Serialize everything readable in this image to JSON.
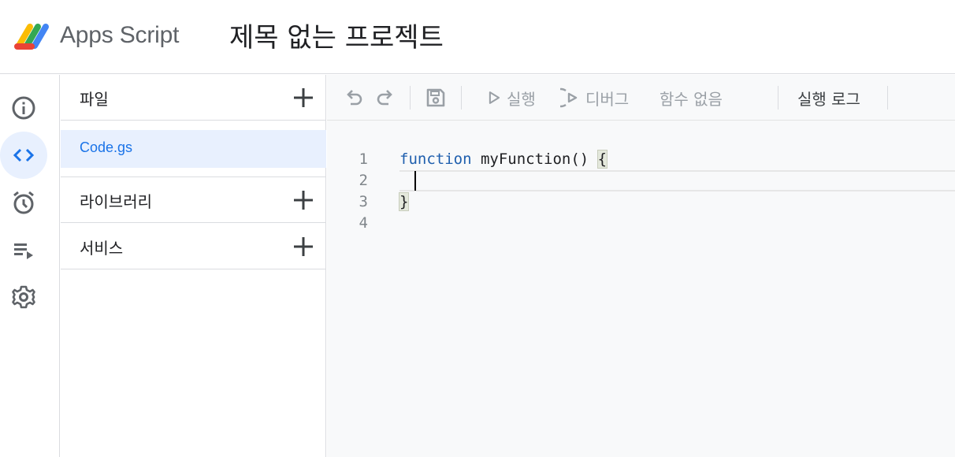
{
  "header": {
    "brand": "Apps Script",
    "project_title": "제목 없는 프로젝트"
  },
  "rail": {
    "items": [
      {
        "icon": "info-icon",
        "active": false
      },
      {
        "icon": "code-icon",
        "active": true
      },
      {
        "icon": "clock-icon",
        "active": false
      },
      {
        "icon": "playlist-icon",
        "active": false
      },
      {
        "icon": "gear-icon",
        "active": false
      }
    ]
  },
  "panel": {
    "files_label": "파일",
    "files": [
      {
        "name": "Code.gs",
        "selected": true
      }
    ],
    "libraries_label": "라이브러리",
    "services_label": "서비스"
  },
  "toolbar": {
    "run_label": "실행",
    "debug_label": "디버그",
    "function_select": "함수 없음",
    "log_label": "실행 로그"
  },
  "editor": {
    "line_numbers": [
      "1",
      "2",
      "3",
      "4"
    ],
    "code": {
      "keyword": "function",
      "rest": " myFunction() ",
      "open_brace": "{",
      "close_brace": "}"
    },
    "colors": {
      "keyword": "#1f5fae",
      "selected_file": "#1a73e8",
      "active_bg": "#e8f0fe"
    }
  }
}
